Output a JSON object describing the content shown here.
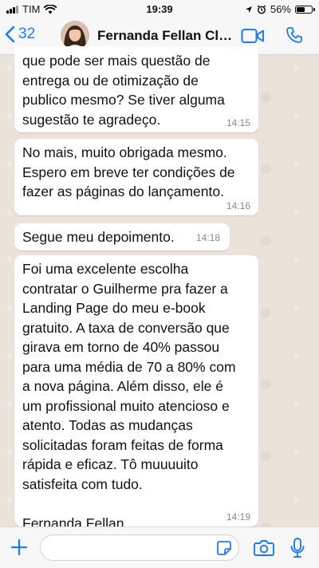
{
  "status_bar": {
    "carrier": "TIM",
    "time": "19:39",
    "battery": "56%",
    "battery_level": 0.56
  },
  "header": {
    "back_count": "32",
    "contact_name": "Fernanda Fellan Cli...",
    "icons": [
      "back-chevron-icon",
      "video-call-icon",
      "phone-call-icon"
    ]
  },
  "messages": [
    {
      "text": "que pode ser mais questão de\nentrega ou de otimização de\npublico mesmo? Se tiver alguma\nsugestão te agradeço.",
      "time": "14:15"
    },
    {
      "text": "No mais, muito obrigada mesmo.\nEspero em breve ter condições de\nfazer as páginas do lançamento.",
      "time": "14:16"
    },
    {
      "text": "Segue meu depoimento.",
      "time": "14:18"
    },
    {
      "text": "Foi uma excelente escolha\ncontratar o Guilherme pra fazer a\nLanding Page do meu e-book\ngratuito. A taxa de conversão que\ngirava em torno de 40% passou\npara uma média de 70 a 80% com\na nova página. Além disso, ele é\num profissional muito atencioso e\natento. Todas as mudanças\nsolicitadas foram feitas de forma\nrápida e eficaz. Tô muuuuito\nsatisfeita com tudo.\n\nFernanda Fellan",
      "time": "14:19"
    }
  ],
  "input_bar": {
    "value": "",
    "icons": [
      "plus-icon",
      "sticker-icon",
      "camera-icon",
      "microphone-icon"
    ]
  },
  "colors": {
    "accent": "#1c7cf4",
    "chat_background": "#e9e3da",
    "bubble": "#ffffff",
    "timestamp": "#8a8a8a"
  }
}
